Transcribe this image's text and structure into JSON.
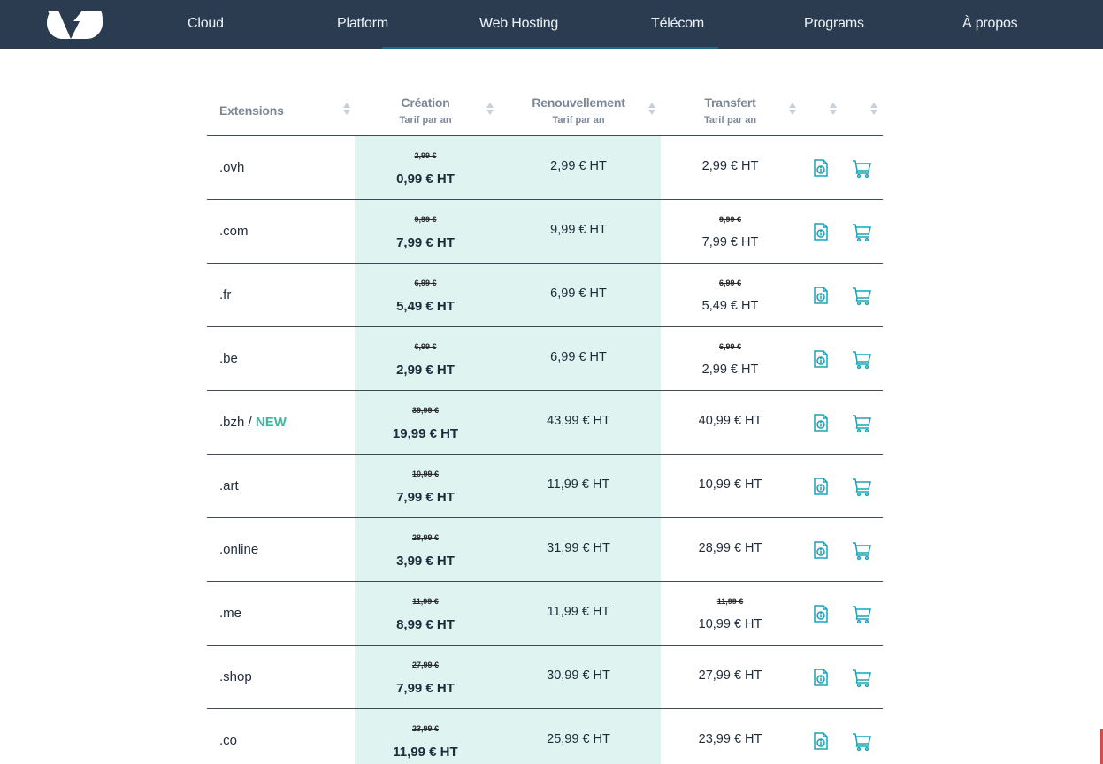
{
  "nav": {
    "items": [
      "Cloud",
      "Platform",
      "Web Hosting",
      "Télécom",
      "Programs",
      "À propos"
    ]
  },
  "table": {
    "headers": {
      "extensions": "Extensions",
      "creation": "Création",
      "creation_sub": "Tarif par an",
      "renewal": "Renouvellement",
      "renewal_sub": "Tarif par an",
      "transfer": "Transfert",
      "transfer_sub": "Tarif par an"
    },
    "rows": [
      {
        "ext": ".ovh",
        "badge": "",
        "creation_old": "2,99 €",
        "creation": "0,99 € HT",
        "renewal": "2,99 € HT",
        "transfer_old": "",
        "transfer": "2,99 € HT"
      },
      {
        "ext": ".com",
        "badge": "",
        "creation_old": "9,99 €",
        "creation": "7,99 € HT",
        "renewal": "9,99 € HT",
        "transfer_old": "9,99 €",
        "transfer": "7,99 € HT"
      },
      {
        "ext": ".fr",
        "badge": "",
        "creation_old": "6,99 €",
        "creation": "5,49 € HT",
        "renewal": "6,99 € HT",
        "transfer_old": "6,99 €",
        "transfer": "5,49 € HT"
      },
      {
        "ext": ".be",
        "badge": "",
        "creation_old": "6,99 €",
        "creation": "2,99 € HT",
        "renewal": "6,99 € HT",
        "transfer_old": "6,99 €",
        "transfer": "2,99 € HT"
      },
      {
        "ext": ".bzh",
        "badge": "NEW",
        "creation_old": "39,99 €",
        "creation": "19,99 € HT",
        "renewal": "43,99 € HT",
        "transfer_old": "",
        "transfer": "40,99 € HT"
      },
      {
        "ext": ".art",
        "badge": "",
        "creation_old": "10,99 €",
        "creation": "7,99 € HT",
        "renewal": "11,99 € HT",
        "transfer_old": "",
        "transfer": "10,99 € HT"
      },
      {
        "ext": ".online",
        "badge": "",
        "creation_old": "28,99 €",
        "creation": "3,99 € HT",
        "renewal": "31,99 € HT",
        "transfer_old": "",
        "transfer": "28,99 € HT"
      },
      {
        "ext": ".me",
        "badge": "",
        "creation_old": "11,99 €",
        "creation": "8,99 € HT",
        "renewal": "11,99 € HT",
        "transfer_old": "11,99 €",
        "transfer": "10,99 € HT"
      },
      {
        "ext": ".shop",
        "badge": "",
        "creation_old": "27,99 €",
        "creation": "7,99 € HT",
        "renewal": "30,99 € HT",
        "transfer_old": "",
        "transfer": "27,99 € HT"
      },
      {
        "ext": ".co",
        "badge": "",
        "creation_old": "23,99 €",
        "creation": "11,99 € HT",
        "renewal": "25,99 € HT",
        "transfer_old": "",
        "transfer": "23,99 € HT"
      }
    ]
  },
  "icons": {
    "info": "info-document-icon",
    "cart": "shopping-cart-icon"
  },
  "colors": {
    "nav_bg": "#2b3c50",
    "highlight_col": "#dff3f1",
    "accent": "#3bb89e",
    "icon": "#1aa3b8"
  }
}
